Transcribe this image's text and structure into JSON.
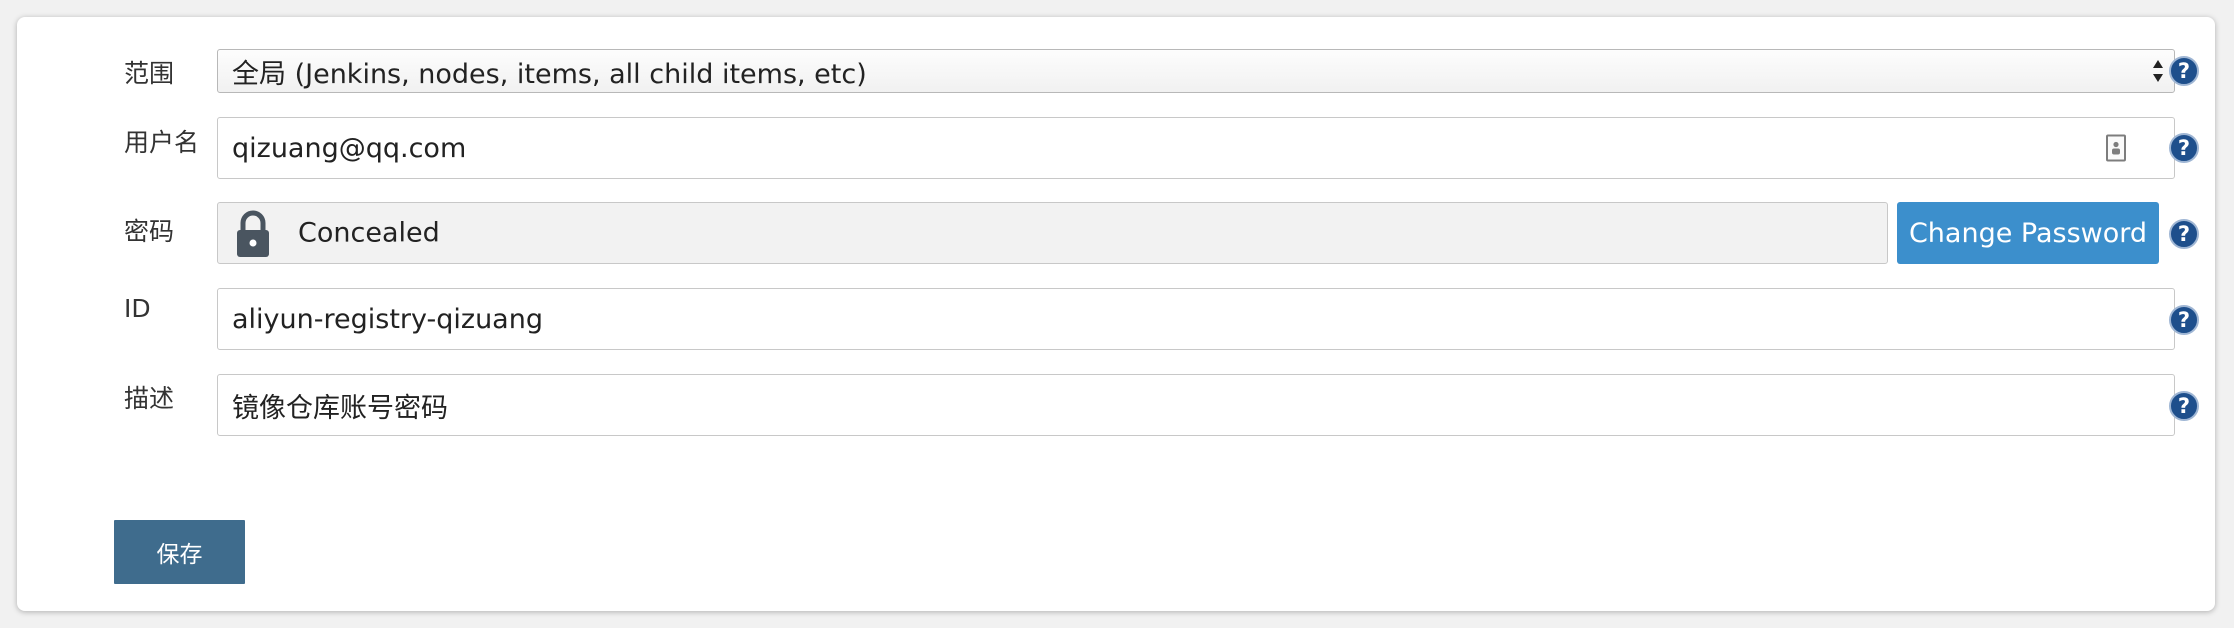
{
  "form": {
    "scope": {
      "label": "范围",
      "value": "全局 (Jenkins, nodes, items, all child items, etc)"
    },
    "username": {
      "label": "用户名",
      "value": "qizuang@qq.com"
    },
    "password": {
      "label": "密码",
      "value": "Concealed",
      "change_label": "Change Password"
    },
    "id": {
      "label": "ID",
      "value": "aliyun-registry-qizuang"
    },
    "description": {
      "label": "描述",
      "value": "镜像仓库账号密码"
    },
    "help_glyph": "?",
    "save_label": "保存"
  },
  "colors": {
    "accent": "#3c8fcc",
    "save_button": "#3f6c8d",
    "help_icon": "#1e4f8c"
  },
  "icons": [
    "select-arrows-icon",
    "contact-card-icon",
    "lock-icon",
    "help-icon"
  ]
}
